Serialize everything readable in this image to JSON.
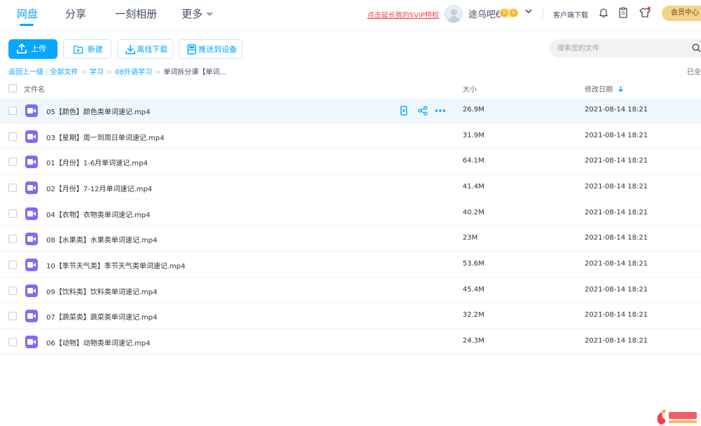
{
  "nav": {
    "tabs": [
      {
        "label": "网盘",
        "active": true
      },
      {
        "label": "分享"
      },
      {
        "label": "一刻相册"
      },
      {
        "label": "更多"
      }
    ],
    "svip_text": "点击延长我的SVIP特权",
    "username": "途乌吧6",
    "badge_left": "S",
    "badge_right": "S",
    "client_download": "客户端下载",
    "member_center": "会员中心"
  },
  "toolbar": {
    "upload": "上传",
    "new": "新建",
    "offline": "离线下载",
    "push": "推送到设备"
  },
  "search": {
    "placeholder": "搜索您的文件"
  },
  "breadcrumb": {
    "back": "返回上一级",
    "all": "全部文件",
    "items": [
      "学习",
      "08外语学习"
    ],
    "current": "单词拆分课【单词..."
  },
  "loaded_text": "已全",
  "table": {
    "headers": {
      "name": "文件名",
      "size": "大小",
      "date": "修改日期"
    },
    "sort_icon": "arrow-down-icon",
    "rows": [
      {
        "name": "05【颜色】颜色类单词速记.mp4",
        "size": "26.9M",
        "date": "2021-08-14 18:21"
      },
      {
        "name": "03【星期】周一到周日单词速记.mp4",
        "size": "31.9M",
        "date": "2021-08-14 18:21"
      },
      {
        "name": "01【月份】1-6月单词速记.mp4",
        "size": "64.1M",
        "date": "2021-08-14 18:21"
      },
      {
        "name": "02【月份】7-12月单词速记.mp4",
        "size": "41.4M",
        "date": "2021-08-14 18:21"
      },
      {
        "name": "04【衣物】衣物类单词速记.mp4",
        "size": "40.2M",
        "date": "2021-08-14 18:21"
      },
      {
        "name": "08【水果类】水果类单词速记.mp4",
        "size": "23M",
        "date": "2021-08-14 18:21"
      },
      {
        "name": "10【季节天气类】季节天气类单词速记.mp4",
        "size": "53.6M",
        "date": "2021-08-14 18:21"
      },
      {
        "name": "09【饮料类】饮料类单词速记.mp4",
        "size": "45.4M",
        "date": "2021-08-14 18:21"
      },
      {
        "name": "07【蔬菜类】蔬菜类单词速记.mp4",
        "size": "32.2M",
        "date": "2021-08-14 18:21"
      },
      {
        "name": "06【动物】动物类单词速记.mp4",
        "size": "24.3M",
        "date": "2021-08-14 18:21"
      }
    ]
  },
  "colors": {
    "accent": "#06a7ff",
    "video_icon": "#7a6ef6",
    "svip_red": "#f2414e",
    "member_gold": "#f5d38a"
  }
}
